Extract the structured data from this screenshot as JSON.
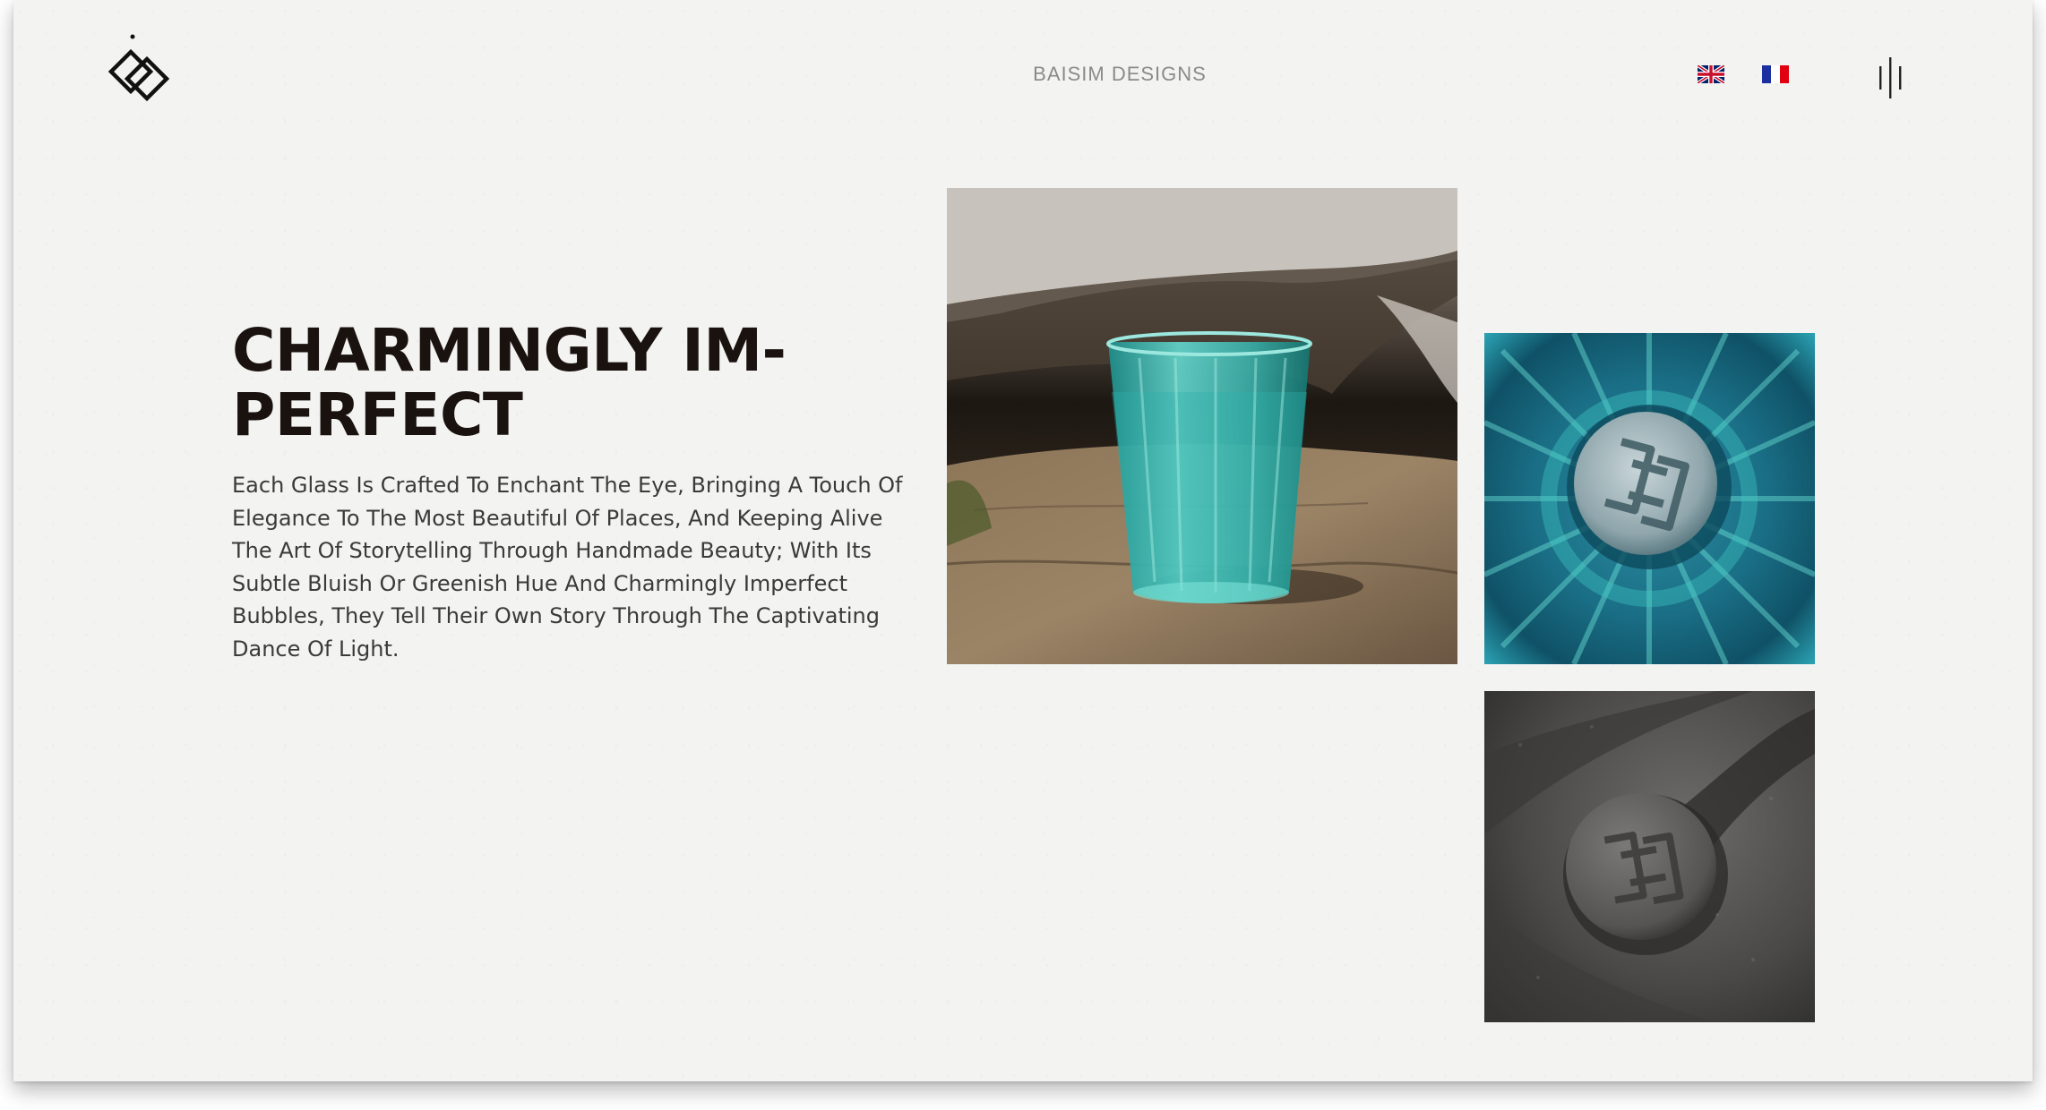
{
  "header": {
    "brand_name": "BAISIM DESIGNS",
    "logo_icon": "diamond-knot-logo-icon",
    "languages": [
      {
        "code": "en",
        "icon": "uk-flag-icon"
      },
      {
        "code": "fr",
        "icon": "france-flag-icon"
      }
    ],
    "menu_icon": "vertical-bars-menu-icon"
  },
  "hero": {
    "title_line1": "CHARMINGLY IM-",
    "title_line2": "PERFECT",
    "description": "Each Glass Is Crafted To Enchant The Eye, Bringing A Touch Of Elegance To The Most Beautiful Of Places, And Keeping Alive The Art Of Storytelling Through Handmade Beauty; With Its Subtle Bluish Or Greenish Hue And Charmingly Imperfect Bubbles, They Tell Their Own Story Through The Captivating Dance Of Light."
  },
  "gallery": {
    "images": [
      {
        "subject": "turquoise glass of water on rock"
      },
      {
        "subject": "glass bottom with embossed logo"
      },
      {
        "subject": "logo stamp in grey sand"
      }
    ]
  },
  "colors": {
    "page_background": "#f3f3f2",
    "title": "#1a120f",
    "body_text": "#3a3a3a",
    "brand_text": "#8a8a8a"
  }
}
